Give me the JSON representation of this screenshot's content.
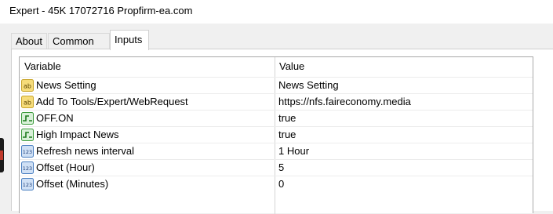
{
  "window": {
    "title": "Expert - 45K 17072716 Propfirm-ea.com"
  },
  "tabs": [
    {
      "label": "About"
    },
    {
      "label": "Common"
    },
    {
      "label": "Inputs",
      "active": true
    }
  ],
  "grid": {
    "columns": {
      "variable": "Variable",
      "value": "Value"
    },
    "rows": [
      {
        "name": "News Setting",
        "value": "News Setting",
        "icon": "string-type-icon"
      },
      {
        "name": "Add To Tools/Expert/WebRequest",
        "value": "https://nfs.faireconomy.media",
        "icon": "string-type-icon"
      },
      {
        "name": "OFF.ON",
        "value": "true",
        "icon": "bool-type-icon"
      },
      {
        "name": "High Impact News",
        "value": "true",
        "icon": "bool-type-icon"
      },
      {
        "name": "Refresh news interval",
        "value": "1 Hour",
        "icon": "int-type-icon"
      },
      {
        "name": "Offset (Hour)",
        "value": "5",
        "icon": "int-type-icon"
      },
      {
        "name": "Offset (Minutes)",
        "value": "0",
        "icon": "int-type-icon"
      }
    ]
  },
  "colors": {
    "string_icon": "#e8c44a",
    "bool_icon": "#3b9b3b",
    "int_icon": "#4a7fc1"
  }
}
